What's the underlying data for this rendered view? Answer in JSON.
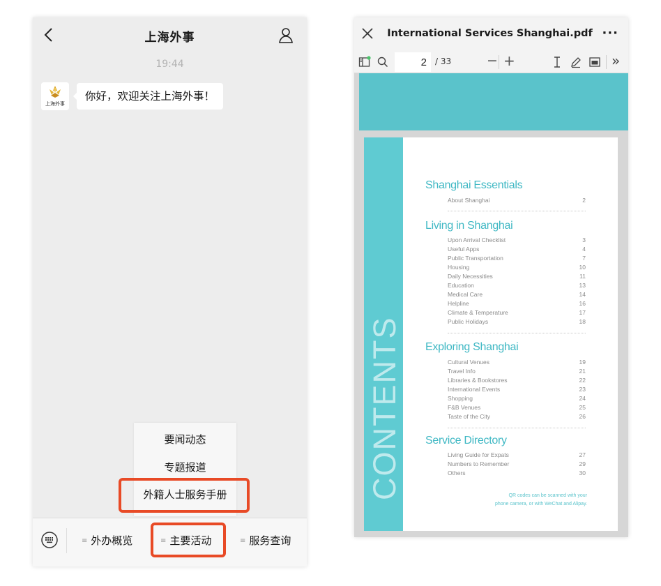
{
  "chat": {
    "title": "上海外事",
    "timestamp": "19:44",
    "message": "你好，欢迎关注上海外事！",
    "avatar_icon": "flower-logo-icon",
    "submenu": [
      "要闻动态",
      "专题报道",
      "外籍人士服务手册"
    ],
    "menu_tabs": [
      "外办概览",
      "主要活动",
      "服务查询"
    ],
    "menu_tab_marker": "≡",
    "highlight_color": "#e84a26"
  },
  "pdf": {
    "title": "International Services Shanghai.pdf",
    "more": "···",
    "page_current": "2",
    "page_total": "/ 33",
    "zoom_out": "−",
    "zoom_in": "+",
    "more_tools": "»",
    "accent_color": "#5fcbd2",
    "contents_label": "CONTENTS",
    "sections": [
      {
        "title": "Shanghai Essentials",
        "items": [
          {
            "label": "About Shanghai",
            "page": "2"
          }
        ]
      },
      {
        "title": "Living in Shanghai",
        "items": [
          {
            "label": "Upon Arrival Checklist",
            "page": "3"
          },
          {
            "label": "Useful Apps",
            "page": "4"
          },
          {
            "label": "Public Transportation",
            "page": "7"
          },
          {
            "label": "Housing",
            "page": "10"
          },
          {
            "label": "Daily Necessities",
            "page": "11"
          },
          {
            "label": "Education",
            "page": "13"
          },
          {
            "label": "Medical Care",
            "page": "14"
          },
          {
            "label": "Helpline",
            "page": "16"
          },
          {
            "label": "Climate & Temperature",
            "page": "17"
          },
          {
            "label": "Public Holidays",
            "page": "18"
          }
        ]
      },
      {
        "title": "Exploring Shanghai",
        "items": [
          {
            "label": "Cultural Venues",
            "page": "19"
          },
          {
            "label": "Travel Info",
            "page": "21"
          },
          {
            "label": "Libraries & Bookstores",
            "page": "22"
          },
          {
            "label": "International Events",
            "page": "23"
          },
          {
            "label": "Shopping",
            "page": "24"
          },
          {
            "label": "F&B Venues",
            "page": "25"
          },
          {
            "label": "Taste of the City",
            "page": "26"
          }
        ]
      },
      {
        "title": "Service Directory",
        "items": [
          {
            "label": "Living Guide for Expats",
            "page": "27"
          },
          {
            "label": "Numbers to Remember",
            "page": "29"
          },
          {
            "label": "Others",
            "page": "30"
          }
        ]
      }
    ],
    "qr_note_1": "QR codes can be scanned with your",
    "qr_note_2": "phone camera, or with WeChat and Alipay."
  }
}
